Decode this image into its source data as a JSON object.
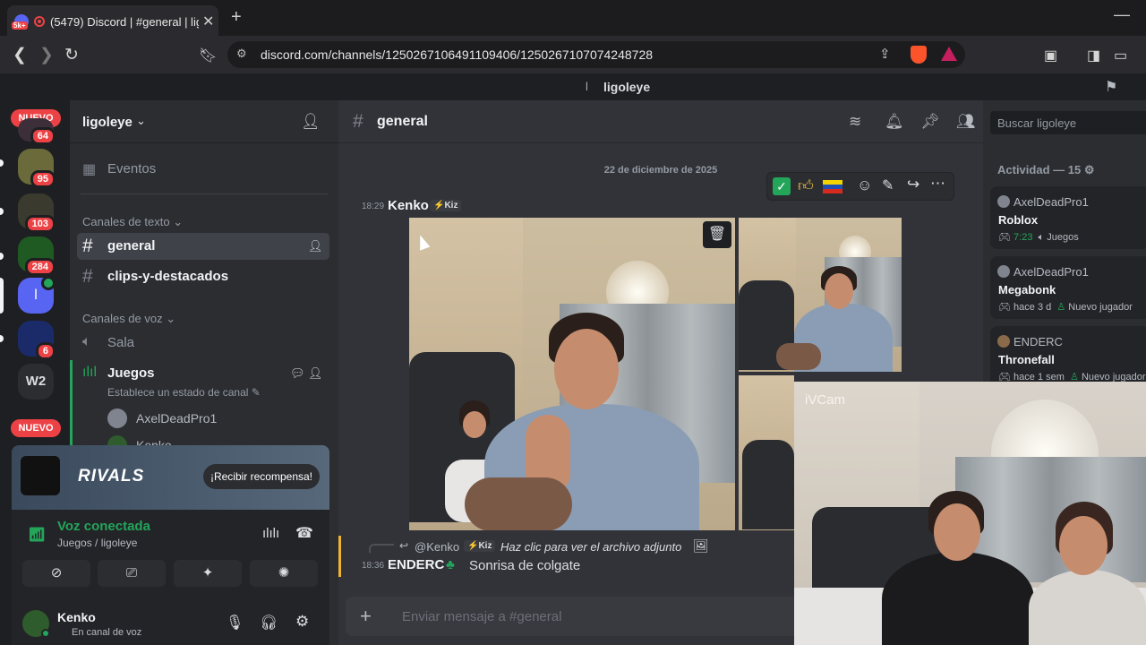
{
  "browser": {
    "tab_title": "(5479) Discord | #general | lig",
    "tab_badge": "5k+",
    "url": "discord.com/channels/1250267106491109406/1250267107074248728"
  },
  "app_title": "ligoleye",
  "app_title_prefix": "l",
  "guilds": [
    {
      "label": "NUEVO",
      "badge": "64"
    },
    {
      "badge": "95"
    },
    {
      "badge": "103"
    },
    {
      "badge": "284"
    },
    {
      "label": "l"
    },
    {
      "badge": "6"
    },
    {
      "label": "W2"
    },
    {
      "label": "NUEVO"
    }
  ],
  "sidebar": {
    "server_name": "ligoleye",
    "events": "Eventos",
    "text_category": "Canales de texto",
    "text_channels": [
      "general",
      "clips-y-destacados"
    ],
    "voice_category": "Canales de voz",
    "voice_channels": [
      "Sala",
      "Juegos"
    ],
    "juegos_status": "Establece un estado de canal",
    "voice_user_1": "AxelDeadPro1",
    "voice_user_2": "Kenko"
  },
  "banner": {
    "game": "RIVALS",
    "button": "¡Recibir recompensa!"
  },
  "voice_panel": {
    "title": "Voz conectada",
    "subtitle": "Juegos / ligoleye"
  },
  "user": {
    "name": "Kenko",
    "status": "En canal de voz"
  },
  "chat": {
    "channel": "general",
    "date": "22 de diciembre de 2025",
    "msg1": {
      "time": "18:29",
      "author": "Kenko",
      "tag": "Kiz"
    },
    "reply": {
      "author": "@Kenko",
      "tag": "Kiz",
      "text": "Haz clic para ver el archivo adjunto"
    },
    "msg2": {
      "time": "18:36",
      "author": "ENDERC",
      "text": "Sonrisa de colgate"
    },
    "input_placeholder": "Enviar mensaje a #general"
  },
  "members": {
    "search_placeholder": "Buscar ligoleye",
    "activity_title": "Actividad — 15",
    "cards": [
      {
        "user": "AxelDeadPro1",
        "game": "Roblox",
        "time": "7:23",
        "extra": "Juegos"
      },
      {
        "user": "AxelDeadPro1",
        "game": "Megabonk",
        "time": "hace 3 d",
        "extra": "Nuevo jugador"
      },
      {
        "user": "ENDERC",
        "game": "Thronefall",
        "time": "hace 1 sem",
        "extra": "Nuevo jugador"
      }
    ]
  },
  "camera_overlay": "iVCam",
  "colors": {
    "accent": "#5865f2",
    "online": "#23a55a",
    "danger": "#ed4245"
  }
}
